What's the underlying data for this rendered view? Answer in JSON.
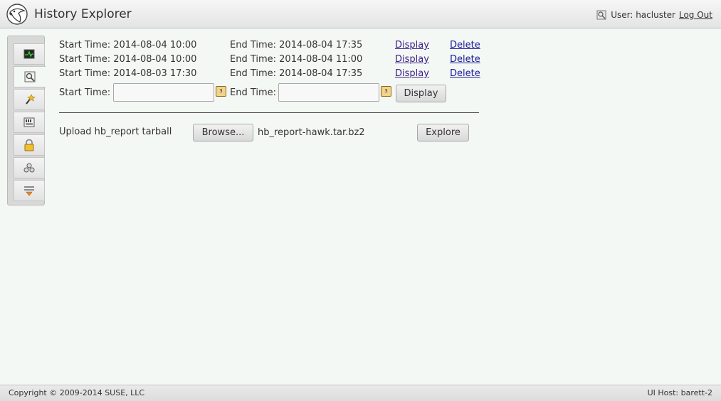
{
  "header": {
    "title": "History Explorer",
    "user_label": "User: hacluster",
    "logout": "Log Out"
  },
  "sidebar": {
    "items": [
      {
        "name": "status-icon"
      },
      {
        "name": "history-icon",
        "active": true
      },
      {
        "name": "wizard-icon"
      },
      {
        "name": "config-icon"
      },
      {
        "name": "access-lock-icon"
      },
      {
        "name": "cluster-setup-icon"
      },
      {
        "name": "network-icon"
      }
    ]
  },
  "history": {
    "rows": [
      {
        "start": "Start Time: 2014-08-04 10:00",
        "end": "End Time: 2014-08-04 17:35",
        "display": "Display",
        "delete": "Delete"
      },
      {
        "start": "Start Time: 2014-08-04 10:00",
        "end": "End Time: 2014-08-04 11:00",
        "display": "Display",
        "delete": "Delete"
      },
      {
        "start": "Start Time: 2014-08-03 17:30",
        "end": "End Time: 2014-08-04 17:35",
        "display": "Display",
        "delete": "Delete"
      }
    ],
    "new_start_label": "Start Time:",
    "new_end_label": "End Time:",
    "new_start_value": "",
    "new_end_value": "",
    "calendar_glyph": "3",
    "display_button": "Display"
  },
  "upload": {
    "label": "Upload hb_report tarball",
    "browse_button": "Browse...",
    "filename": "hb_report-hawk.tar.bz2",
    "explore_button": "Explore"
  },
  "footer": {
    "copyright": "Copyright © 2009-2014 SUSE, LLC",
    "host": "UI Host: barett-2"
  }
}
